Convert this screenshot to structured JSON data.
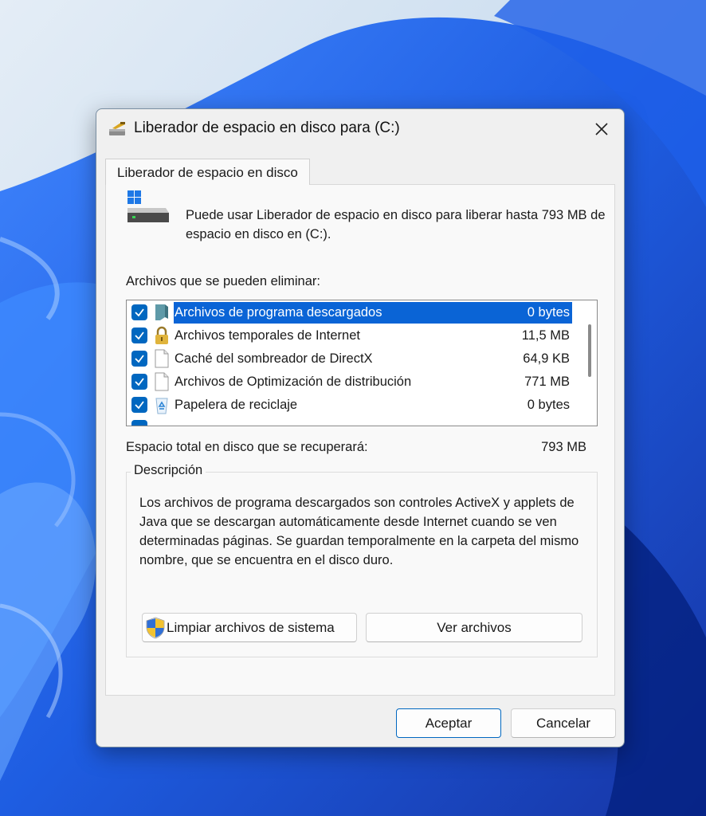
{
  "window": {
    "title": "Liberador de espacio en disco para  (C:)"
  },
  "tabs": [
    {
      "label": "Liberador de espacio en disco",
      "active": true
    }
  ],
  "intro": {
    "text": "Puede usar Liberador de espacio en disco para liberar hasta 793 MB de espacio en disco en  (C:)."
  },
  "files": {
    "label": "Archivos que se pueden eliminar:",
    "items": [
      {
        "name": "Archivos de programa descargados",
        "size": "0 bytes",
        "checked": true,
        "selected": true,
        "icon": "folder-icon"
      },
      {
        "name": "Archivos temporales de Internet",
        "size": "11,5 MB",
        "checked": true,
        "selected": false,
        "icon": "lock-icon"
      },
      {
        "name": "Caché del sombreador de DirectX",
        "size": "64,9 KB",
        "checked": true,
        "selected": false,
        "icon": "file-icon"
      },
      {
        "name": "Archivos de Optimización de distribución",
        "size": "771 MB",
        "checked": true,
        "selected": false,
        "icon": "file-icon"
      },
      {
        "name": "Papelera de reciclaje",
        "size": "0 bytes",
        "checked": true,
        "selected": false,
        "icon": "recycle-bin-icon"
      }
    ]
  },
  "total": {
    "label": "Espacio total en disco que se recuperará:",
    "value": "793 MB"
  },
  "description": {
    "legend": "Descripción",
    "text": "Los archivos de programa descargados son controles ActiveX y applets de Java que se descargan automáticamente desde Internet cuando se ven determinadas páginas. Se guardan temporalmente en la carpeta del mismo nombre, que se encuentra en el disco duro."
  },
  "buttons": {
    "clean_system": "Limpiar archivos de sistema",
    "view_files": "Ver archivos",
    "ok": "Aceptar",
    "cancel": "Cancelar"
  },
  "colors": {
    "accent": "#0067c0",
    "selection": "#0a64d6",
    "dialog_bg": "#f0f0f0"
  }
}
